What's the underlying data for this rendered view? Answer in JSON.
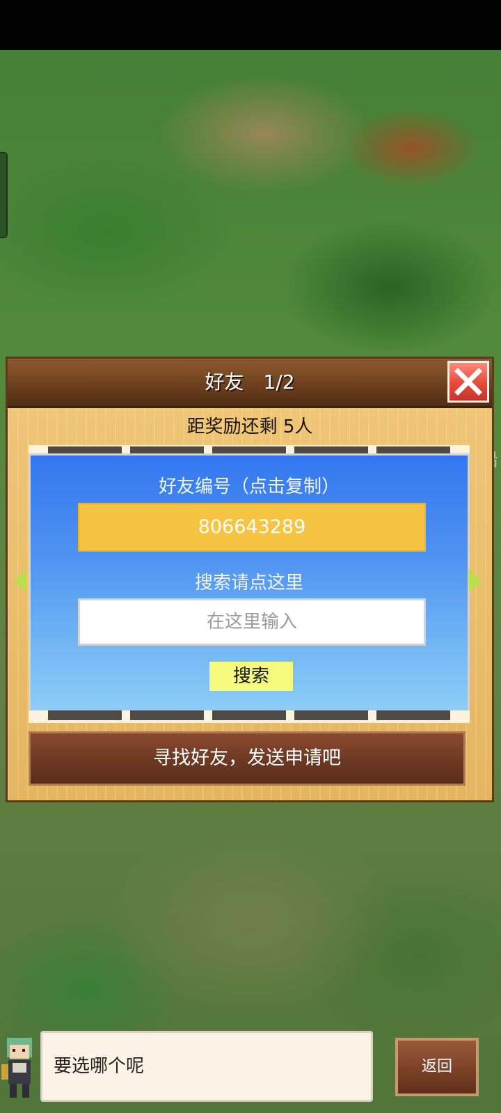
{
  "dialog": {
    "title": "好友　1/2",
    "reward_text": "距奖励还剩 5人"
  },
  "friend_panel": {
    "id_label": "好友编号（点击复制）",
    "friend_id": "806643289",
    "search_label": "搜索请点这里",
    "search_placeholder": "在这里输入",
    "search_button": "搜索"
  },
  "find_button": "寻找好友，发送申请吧",
  "side_glimpse_text": "铅",
  "speech_text": "要选哪个呢",
  "back_button": "返回",
  "colors": {
    "title_bar": "#6e4020",
    "close_button": "#e44b3c",
    "panel_blue": "#4f93f1",
    "id_box": "#f5c443",
    "search_button": "#f5fa7d",
    "arrow": "#b8e04a",
    "find_button": "#6e3a24",
    "back_button": "#7b4128"
  },
  "icons": [
    "close-icon",
    "arrow-left-icon",
    "arrow-right-icon",
    "character-avatar-icon"
  ]
}
